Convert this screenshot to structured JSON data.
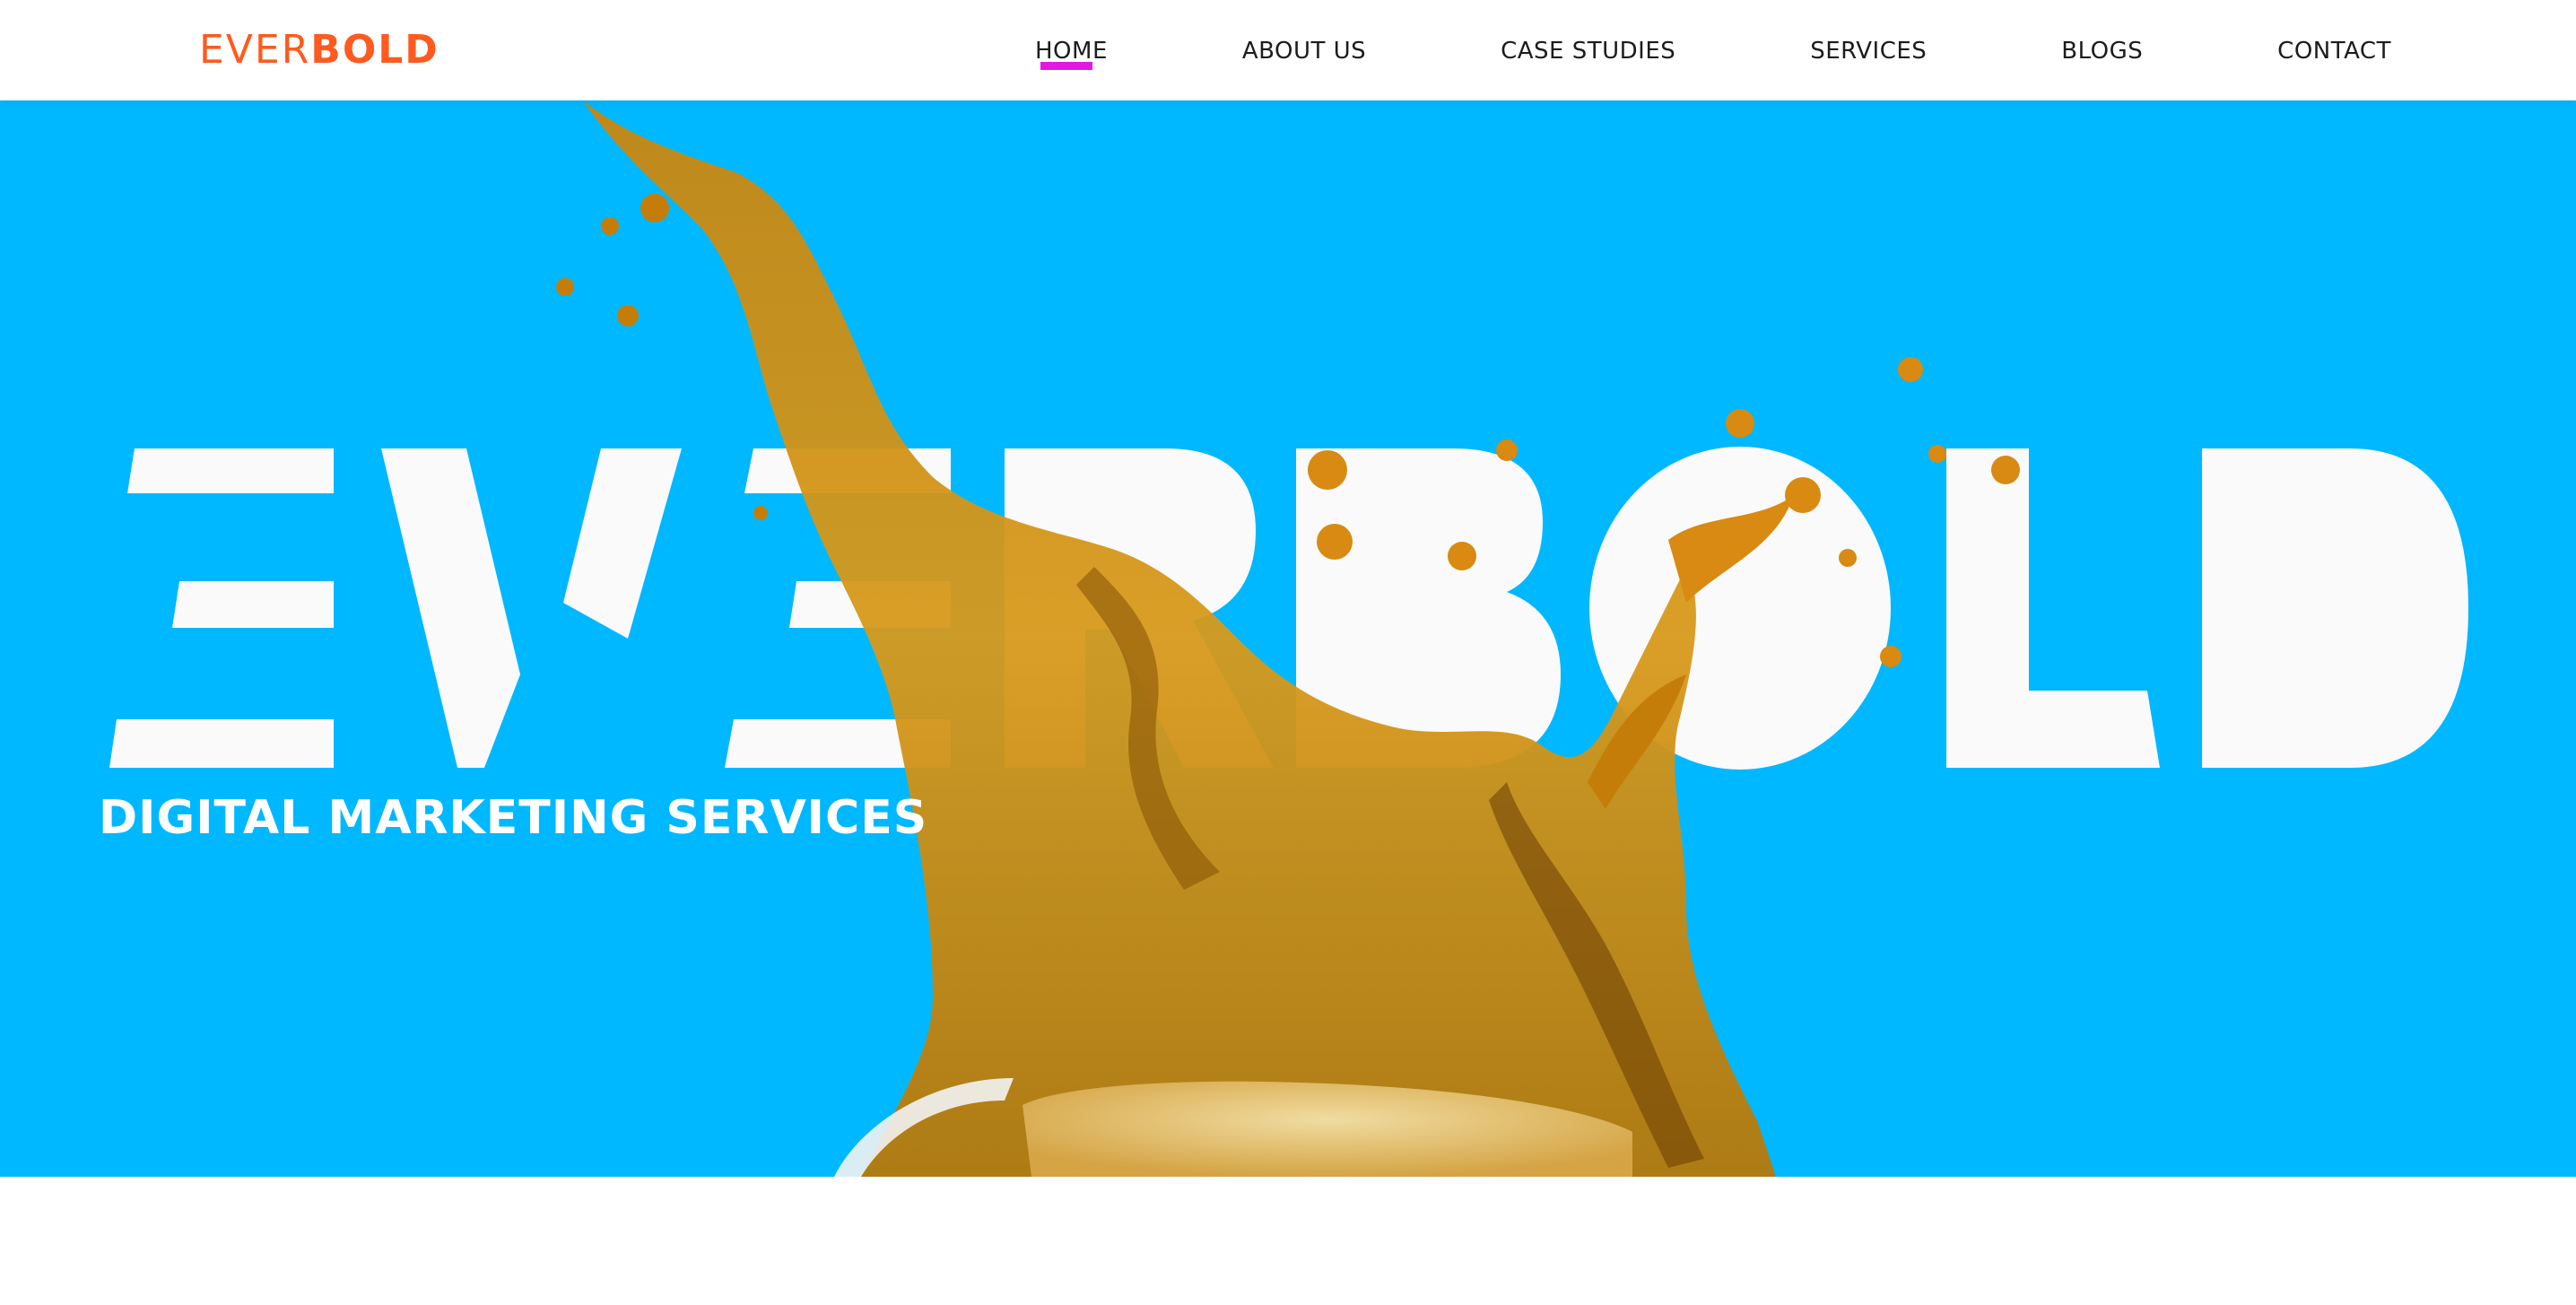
{
  "brand": {
    "logo_thin": "EVER",
    "logo_bold": "BOLD",
    "accent_color": "#ff5a1f",
    "hero_color": "#00b8ff"
  },
  "nav": {
    "items": [
      {
        "label": "HOME",
        "active": true
      },
      {
        "label": "ABOUT US",
        "active": false
      },
      {
        "label": "CASE STUDIES",
        "active": false
      },
      {
        "label": "SERVICES",
        "active": false
      },
      {
        "label": "BLOGS",
        "active": false
      },
      {
        "label": "CONTACT",
        "active": false
      }
    ],
    "active_underline_color": "#e01be0"
  },
  "hero": {
    "big_letters": [
      "E",
      "V",
      "E",
      "R",
      "B",
      "O",
      "L",
      "D"
    ],
    "tagline": "DIGITAL MARKETING SERVICES",
    "image": "coffee-splash"
  }
}
